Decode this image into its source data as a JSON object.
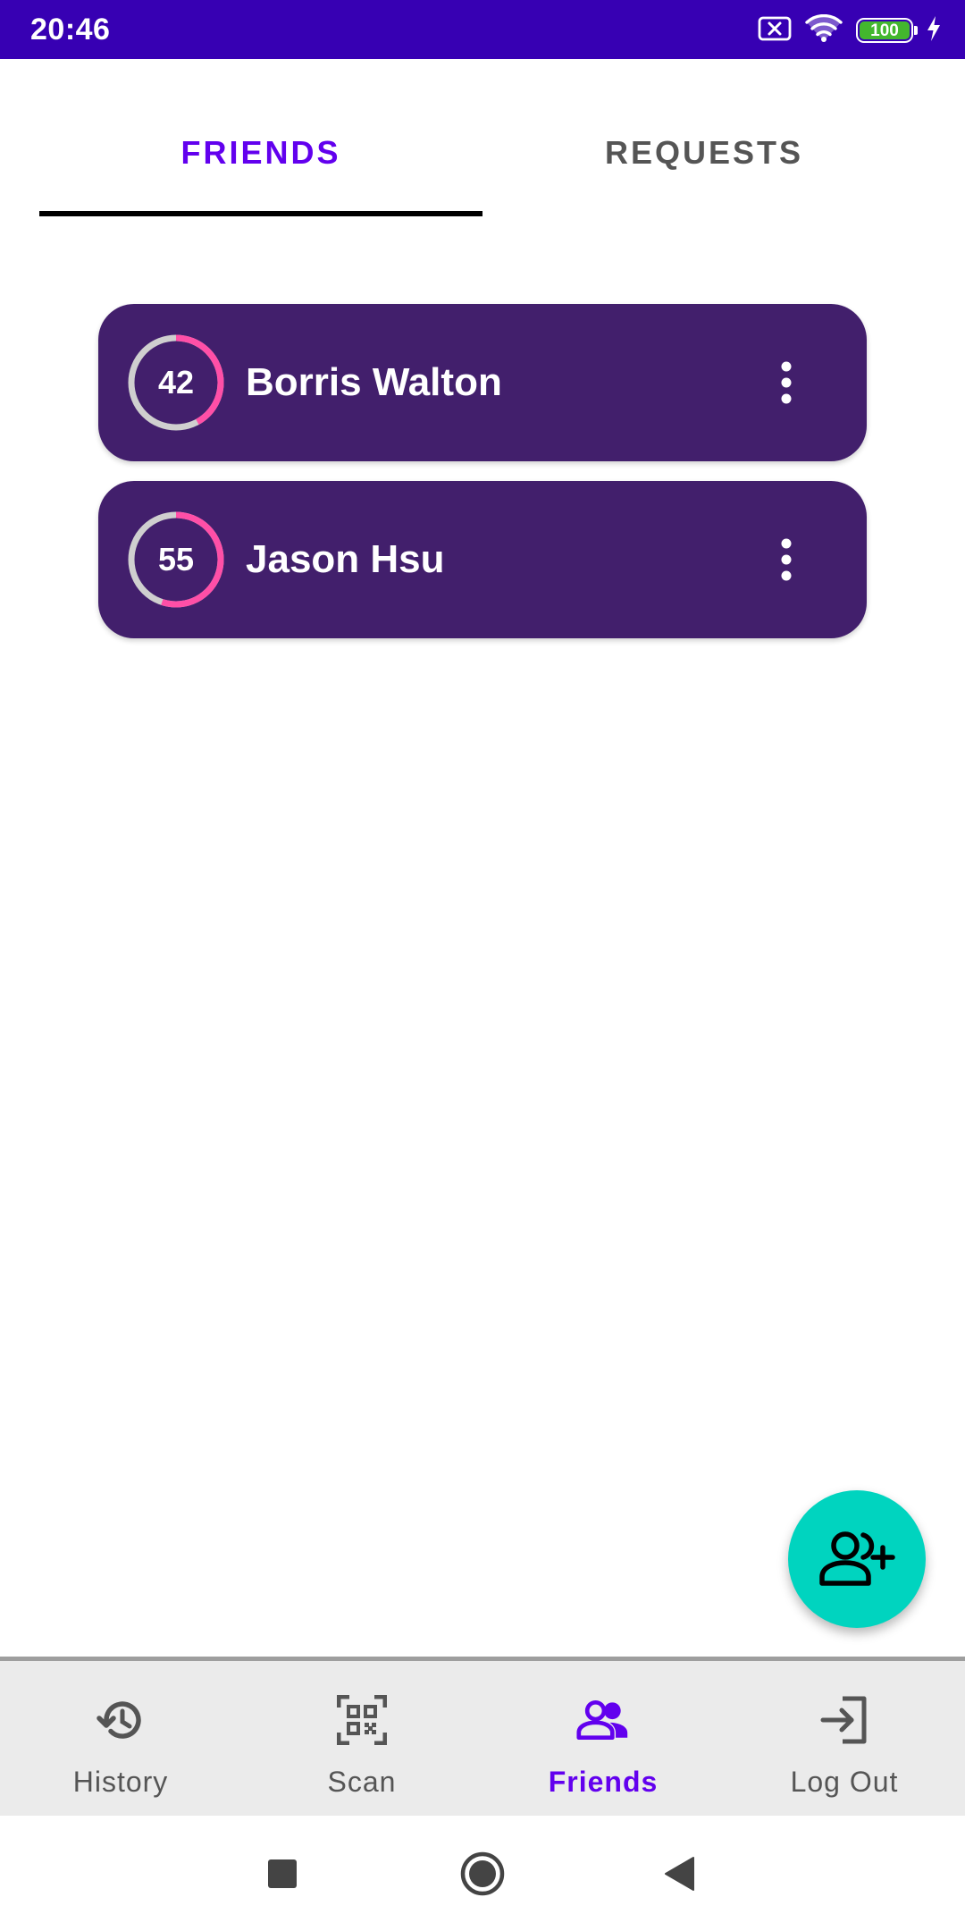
{
  "status_bar": {
    "time": "20:46",
    "battery": "100",
    "icons": [
      "sim-x-icon",
      "wifi-icon",
      "battery-icon",
      "charging-icon"
    ]
  },
  "tabs": [
    {
      "label": "FRIENDS",
      "selected": true
    },
    {
      "label": "REQUESTS",
      "selected": false
    }
  ],
  "friends": [
    {
      "score": "42",
      "score_fraction": 0.42,
      "name": "Borris Walton"
    },
    {
      "score": "55",
      "score_fraction": 0.55,
      "name": "Jason Hsu"
    }
  ],
  "fab": {
    "icon": "add-friend-icon"
  },
  "bottom_nav": [
    {
      "label": "History",
      "icon": "history-icon",
      "active": false
    },
    {
      "label": "Scan",
      "icon": "qr-code-icon",
      "active": false
    },
    {
      "label": "Friends",
      "icon": "people-icon",
      "active": true
    },
    {
      "label": "Log Out",
      "icon": "login-arrow-icon",
      "active": false
    }
  ],
  "colors": {
    "status_bar": "#3700b3",
    "accent": "#6200ee",
    "card": "#421f6c",
    "ring_progress": "#ff4fa7",
    "ring_track": "#cfcfcf",
    "fab": "#00d4bf"
  }
}
